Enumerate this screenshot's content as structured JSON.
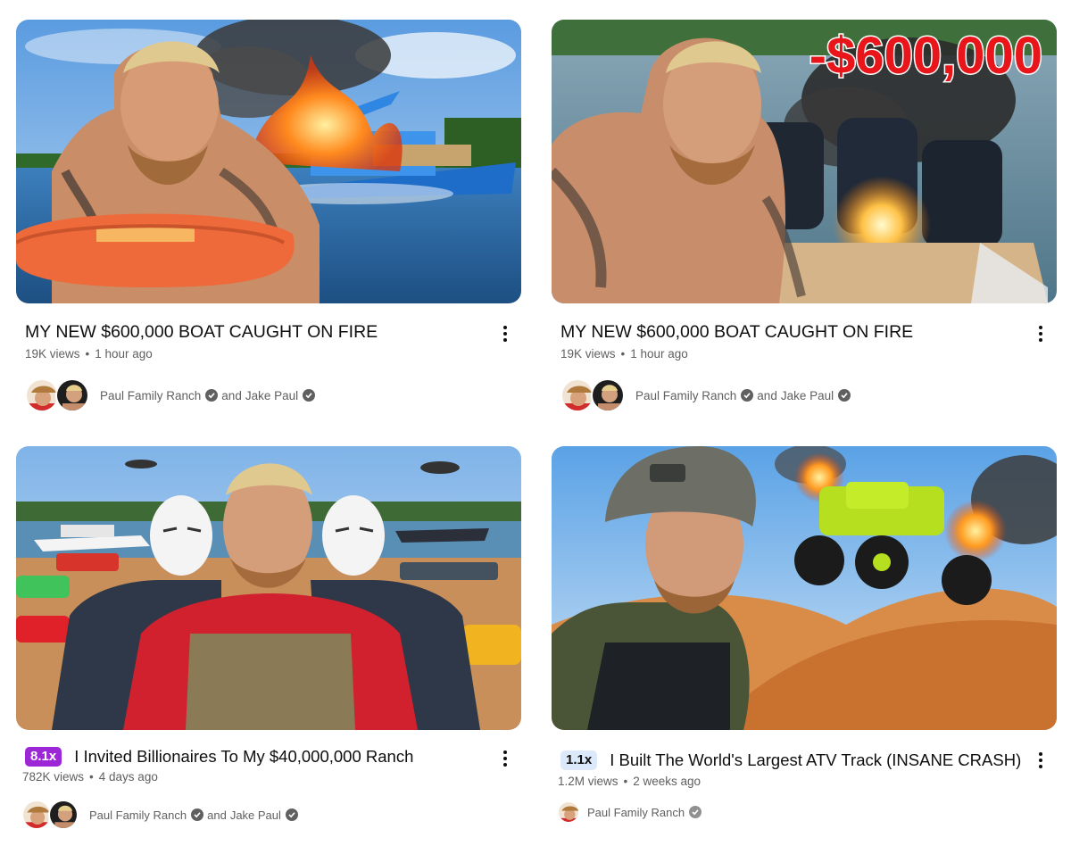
{
  "videos": [
    {
      "title": "MY NEW $600,000 BOAT CAUGHT ON FIRE",
      "views": "19K views",
      "age": "1 hour ago",
      "channels": [
        "Paul Family Ranch",
        "Jake Paul"
      ],
      "and_text": "and"
    },
    {
      "title": "MY NEW $600,000 BOAT CAUGHT ON FIRE",
      "views": "19K views",
      "age": "1 hour ago",
      "channels": [
        "Paul Family Ranch",
        "Jake Paul"
      ],
      "and_text": "and",
      "thumbnail_text": "-$600,000"
    },
    {
      "badge": "8.1x",
      "title": "I Invited Billionaires To My $40,000,000 Ranch",
      "views": "782K views",
      "age": "4 days ago",
      "channels": [
        "Paul Family Ranch",
        "Jake Paul"
      ],
      "and_text": "and"
    },
    {
      "badge": "1.1x",
      "title": "I Built The World's Largest ATV Track (INSANE CRASH)",
      "views": "1.2M views",
      "age": "2 weeks ago",
      "channels": [
        "Paul Family Ranch"
      ]
    }
  ],
  "separator": "•",
  "colors": {
    "badge_purple": "#9b27d6",
    "badge_blue": "#dbe9fb",
    "meta_text": "#606060",
    "title_text": "#0f0f0f"
  },
  "icons": [
    "more-vert-icon",
    "verified-check-icon"
  ]
}
